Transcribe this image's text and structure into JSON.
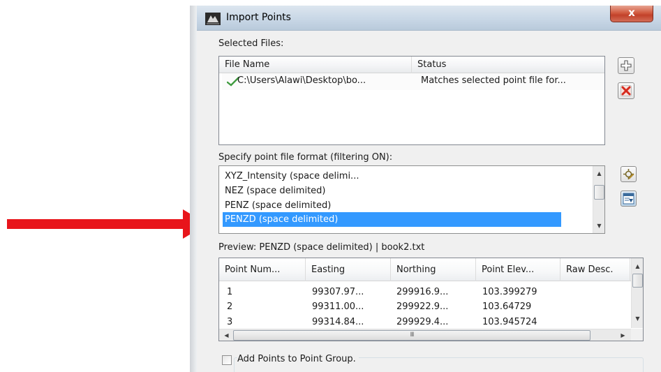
{
  "window": {
    "title": "Import Points",
    "close_label": "x"
  },
  "selected_files": {
    "label": "Selected Files:",
    "columns": [
      "File Name",
      "Status"
    ],
    "rows": [
      {
        "file_name": "C:\\Users\\Alawi\\Desktop\\bo...",
        "status": "Matches selected point file for..."
      }
    ]
  },
  "format": {
    "label": "Specify point file format (filtering ON):",
    "items": [
      "XYZ_Intensity (space delimi...",
      "NEZ (space delimited)",
      "PENZ (space delimited)",
      "PENZD (space delimited)"
    ],
    "selected_index": 3
  },
  "preview": {
    "label": "Preview: PENZD (space delimited) | book2.txt",
    "columns": [
      "Point Num...",
      "Easting",
      "Northing",
      "Point Elev...",
      "Raw Desc."
    ],
    "rows": [
      [
        "1",
        "99307.97...",
        "299916.9...",
        "103.399279",
        ""
      ],
      [
        "2",
        "99311.00...",
        "299922.9...",
        "103.64729",
        ""
      ],
      [
        "3",
        "99314.84...",
        "299929.4...",
        "103.945724",
        ""
      ]
    ],
    "hscroll_grip": "III"
  },
  "options": {
    "add_to_group_label": "Add Points to Point Group."
  },
  "icons": {
    "title": "civil3d-app-icon",
    "add": "add-file-icon",
    "remove": "remove-file-icon",
    "manage_formats": "manage-formats-icon",
    "edit_format": "edit-format-icon",
    "check": "checkmark-icon"
  },
  "colors": {
    "selection": "#3399ff",
    "arrow": "#e8151b",
    "close": "#c2412a"
  }
}
